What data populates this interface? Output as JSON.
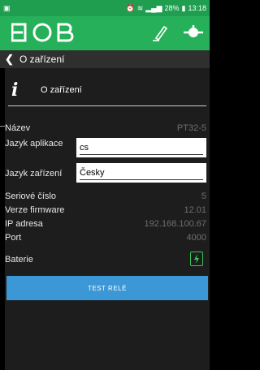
{
  "status": {
    "left_icon": "image-icon",
    "alarm": "alarm-icon",
    "wifi": "wifi-icon",
    "signal": "signal-icon",
    "battery": "28%",
    "time": "13:18"
  },
  "toolbar": {
    "logo": "EOB",
    "edit_icon": "pencil-icon",
    "connect_icon": "plug-icon"
  },
  "nav": {
    "back_icon": "chevron-left-icon",
    "title": "O zařízení"
  },
  "header": {
    "icon": "info-icon",
    "title": "O zařízení"
  },
  "fields": {
    "nazev": {
      "label": "Název",
      "value": "PT32-5"
    },
    "jazyk_aplikace": {
      "label": "Jazyk aplikace",
      "value": "cs"
    },
    "jazyk_zarizeni": {
      "label": "Jazyk zařízení",
      "value": "Česky"
    },
    "seriove_cislo": {
      "label": "Seriové číslo",
      "value": "5"
    },
    "verze_firmware": {
      "label": "Verze firmware",
      "value": "12.01"
    },
    "ip_adresa": {
      "label": "IP adresa",
      "value": "192.168.100.67"
    },
    "port": {
      "label": "Port",
      "value": "4000"
    },
    "baterie": {
      "label": "Baterie",
      "icon": "battery-charging-icon"
    }
  },
  "button": {
    "label": "TEST RELÉ"
  },
  "colors": {
    "status": "#1f9e4f",
    "toolbar": "#27b05a",
    "button": "#3c97d6",
    "battery": "#39c45c"
  }
}
